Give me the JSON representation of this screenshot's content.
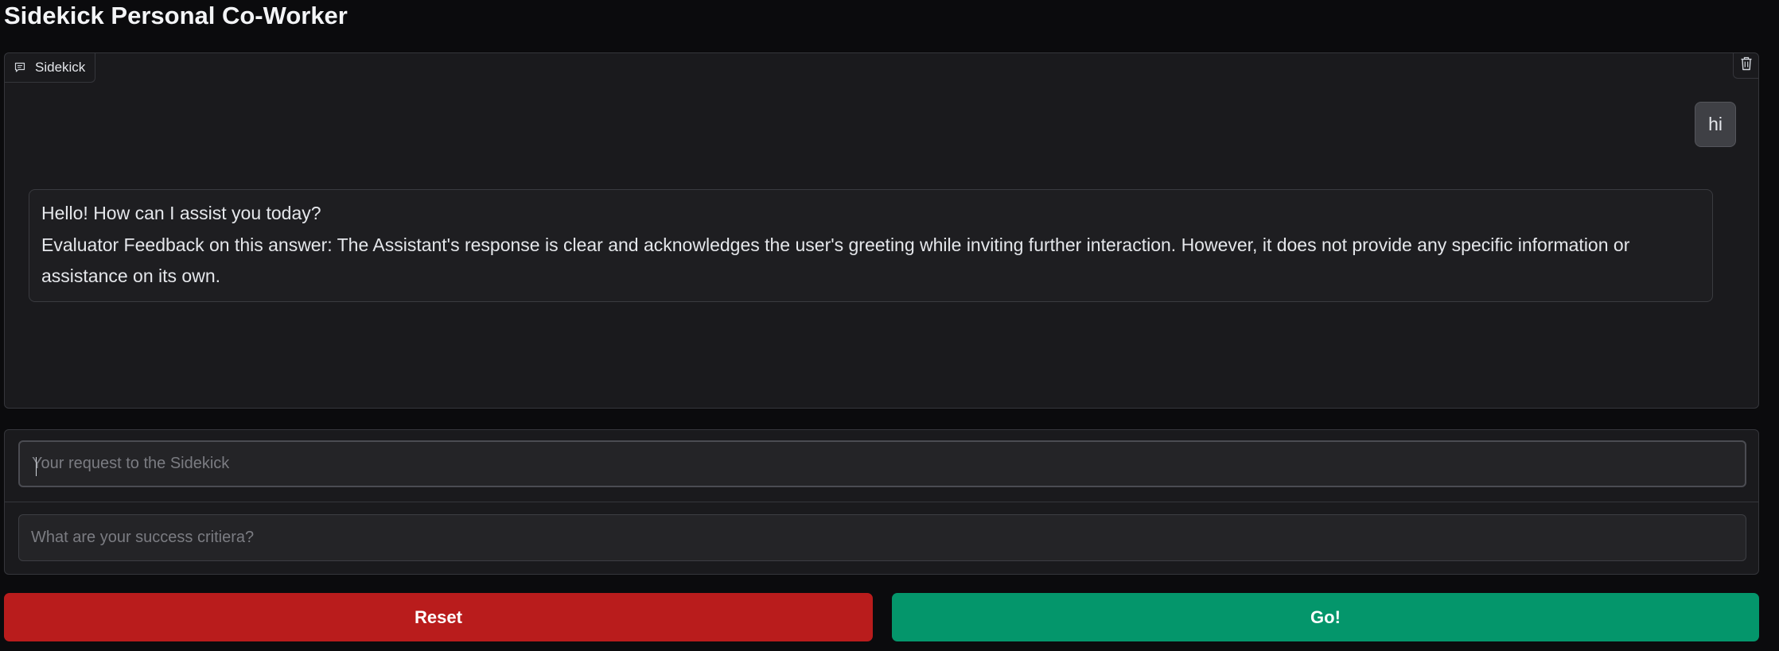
{
  "app": {
    "title": "Sidekick Personal Co-Worker"
  },
  "chatbot": {
    "label": "Sidekick",
    "messages": [
      {
        "role": "user",
        "text": "hi"
      },
      {
        "role": "assistant",
        "text": "Hello! How can I assist you today?",
        "feedback": "Evaluator Feedback on this answer: The Assistant's response is clear and acknowledges the user's greeting while inviting further interaction. However, it does not provide any specific information or assistance on its own."
      }
    ]
  },
  "inputs": {
    "request": {
      "placeholder": "Your request to the Sidekick",
      "value": ""
    },
    "criteria": {
      "placeholder": "What are your success critiera?",
      "value": ""
    }
  },
  "buttons": {
    "reset": "Reset",
    "go": "Go!"
  },
  "colors": {
    "reset": "#b91c1c",
    "go": "#04966b",
    "background": "#0b0b0d",
    "panel": "#1a1a1d"
  },
  "icons": {
    "chat_label": "chat-bubble-icon",
    "clear": "trash-icon"
  }
}
